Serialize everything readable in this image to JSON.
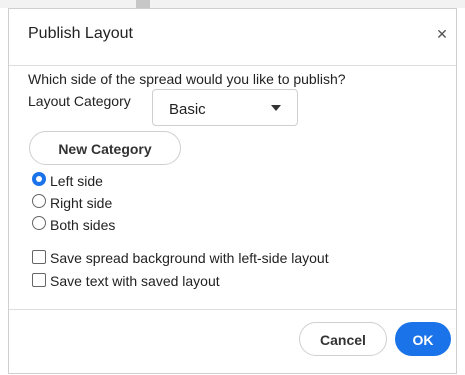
{
  "dialog": {
    "title": "Publish Layout",
    "close_icon": "close-icon"
  },
  "body": {
    "question": "Which side of the spread would you like to publish?",
    "category_label": "Layout Category",
    "category_select": {
      "value": "Basic"
    },
    "new_category_button": "New Category",
    "radio_options": [
      {
        "label": "Left side",
        "checked": true
      },
      {
        "label": "Right side",
        "checked": false
      },
      {
        "label": "Both sides",
        "checked": false
      }
    ],
    "checkboxes": [
      {
        "label": "Save spread background with left-side layout",
        "checked": false
      },
      {
        "label": "Save text with saved layout",
        "checked": false
      }
    ]
  },
  "footer": {
    "cancel_button": "Cancel",
    "ok_button": "OK"
  },
  "colors": {
    "accent": "#1a73e8"
  }
}
